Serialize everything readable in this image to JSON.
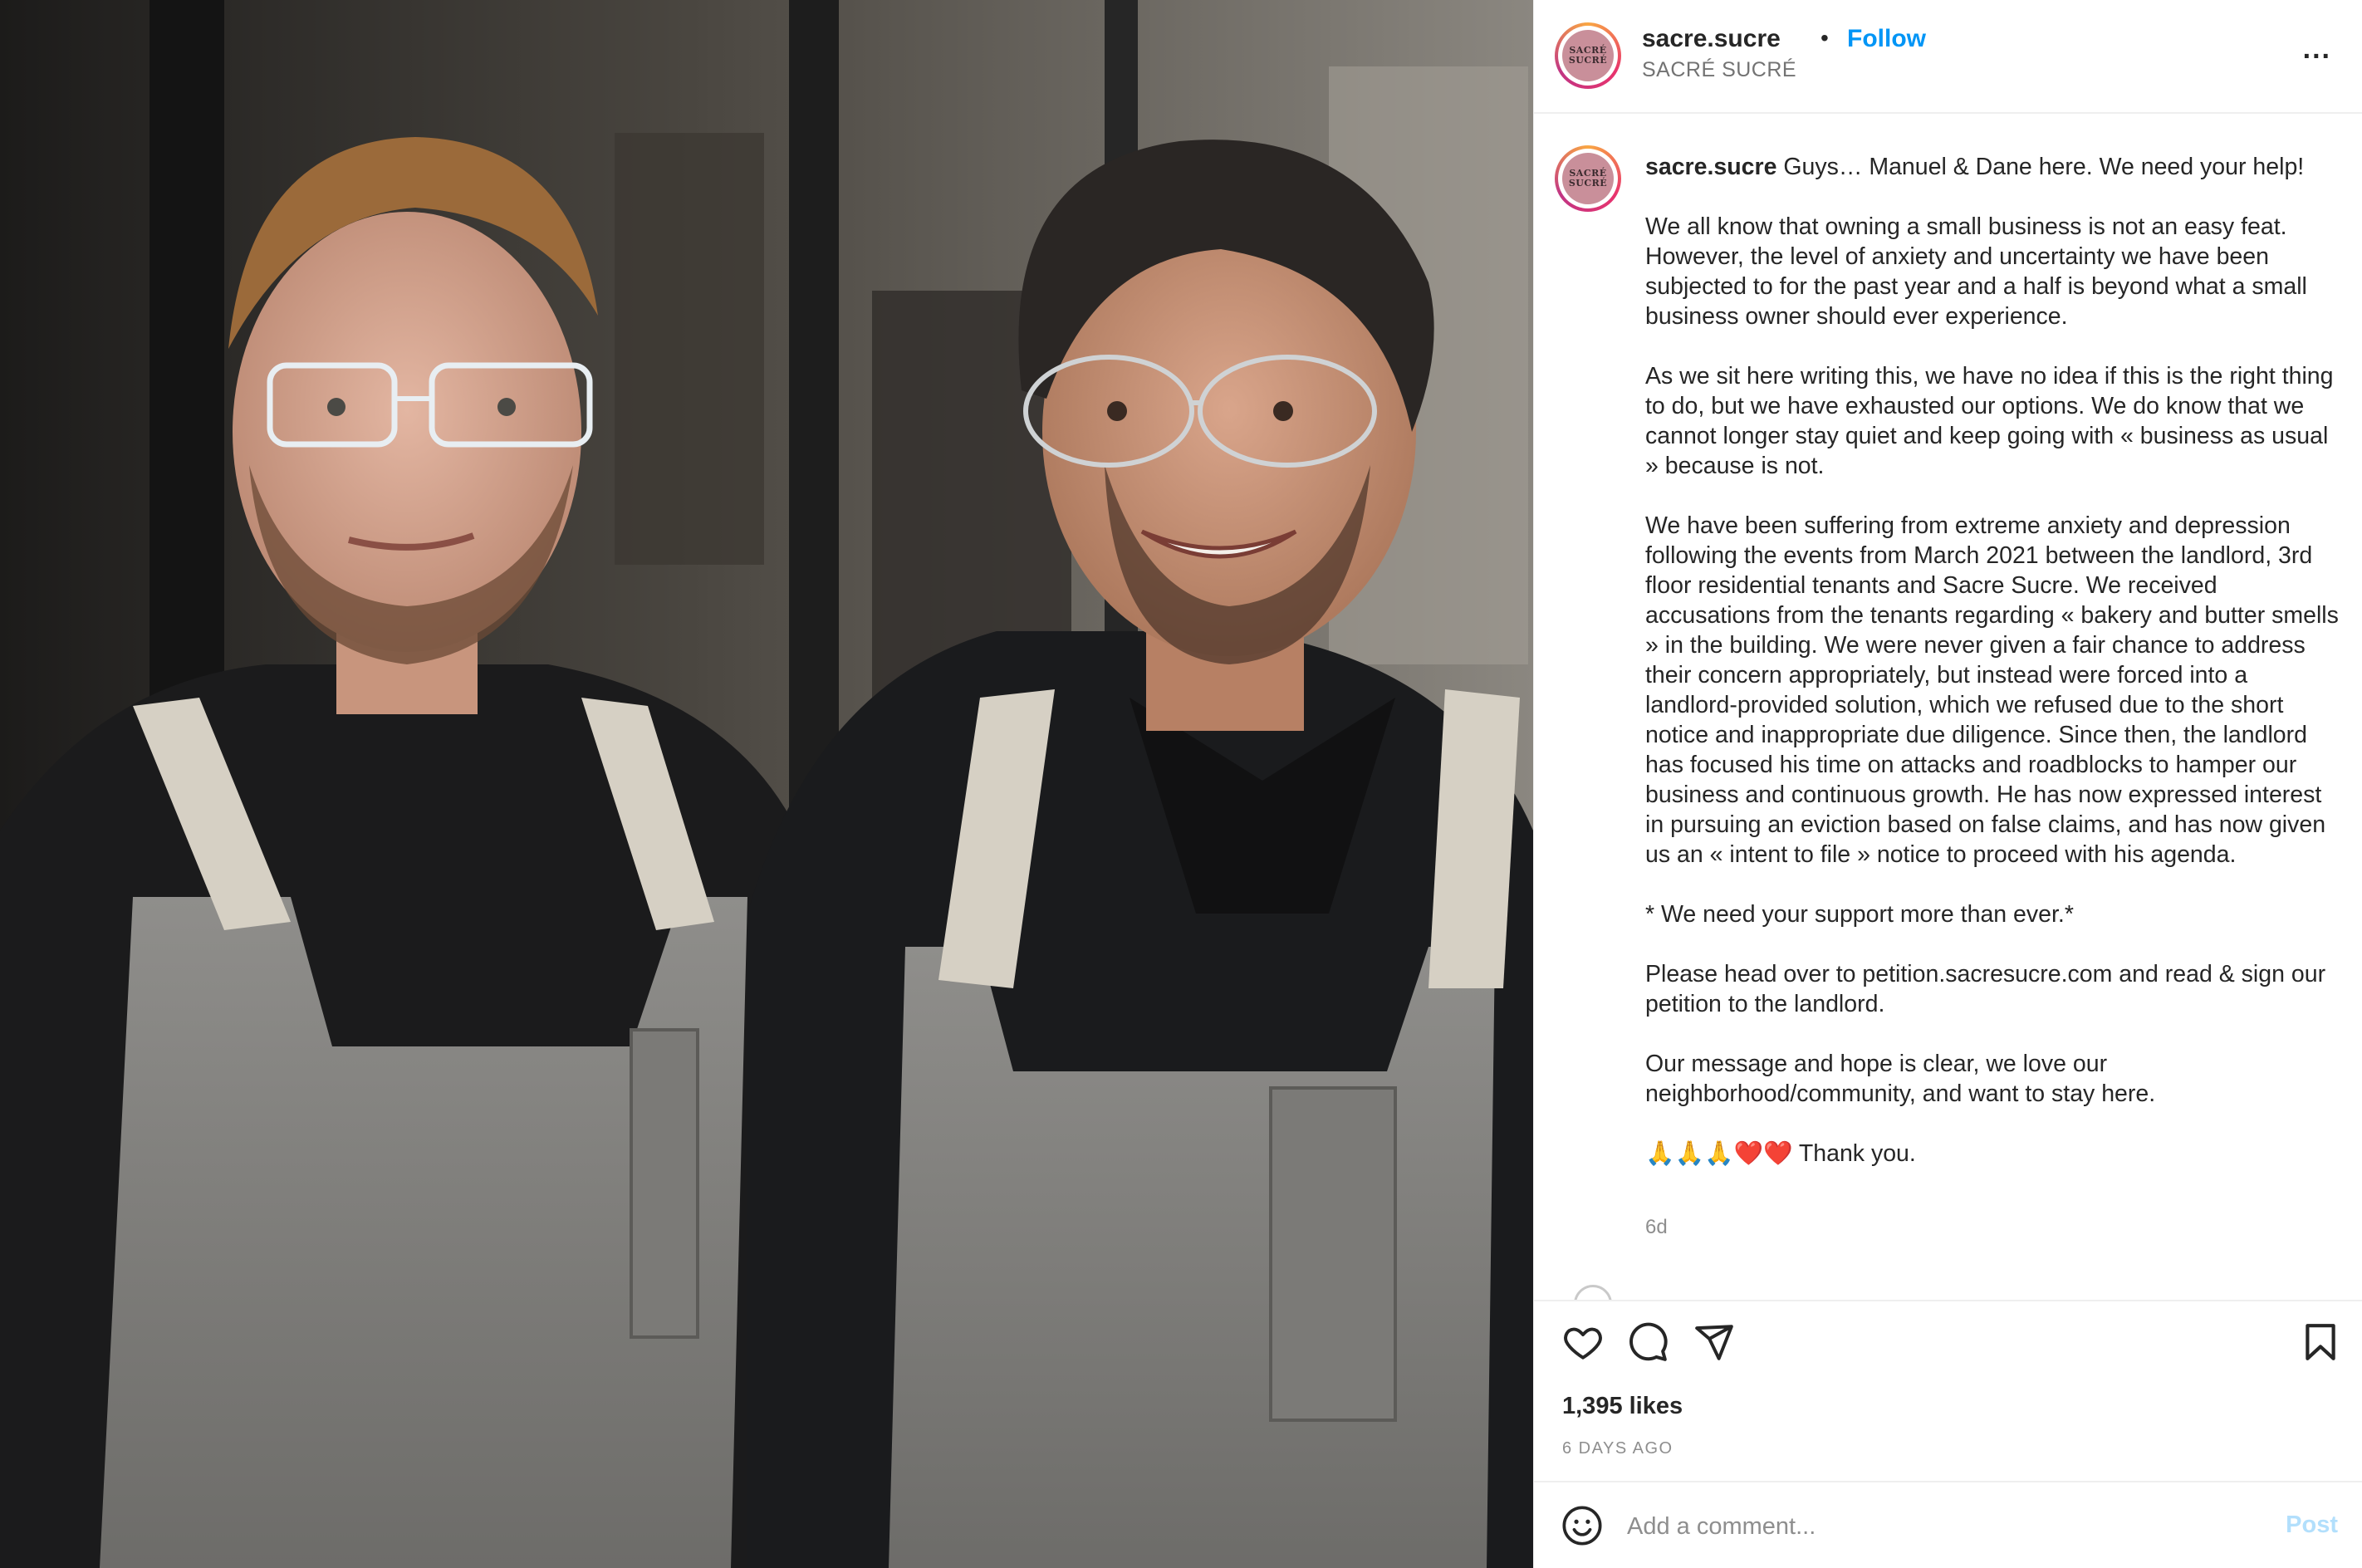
{
  "post": {
    "photo_alt": "Two bakers in grey aprons",
    "avatar_text_line1": "SACRÉ",
    "avatar_text_line2": "SUCRÉ"
  },
  "header": {
    "username": "sacre.sucre",
    "separator": "•",
    "follow_label": "Follow",
    "subtitle": "SACRÉ SUCRÉ",
    "more_icon": "more-horizontal-icon",
    "more_label": "..."
  },
  "caption": {
    "username": "sacre.sucre",
    "text": " Guys… Manuel & Dane here. We need your help!\n\nWe all know that owning a small business is not an easy feat. However, the level of anxiety and uncertainty we have been subjected to for the past year and a half is beyond what a small business owner should ever experience.\n\nAs we sit here writing this, we have no idea if this is the right thing to do, but we have exhausted our options. We do know that we cannot longer stay quiet and keep going with « business as usual » because is not.\n\nWe have been suffering from extreme anxiety and depression following the events from March 2021 between the landlord, 3rd floor residential tenants and Sacre Sucre. We received accusations from the tenants regarding « bakery and butter smells » in the building. We were never given a fair chance to address their concern appropriately, but instead were forced into a landlord-provided solution, which we refused due to the short notice and inappropriate due diligence. Since then, the landlord has focused his time on attacks and roadblocks to hamper our business and continuous growth. He has now expressed interest in pursuing an eviction based on false claims, and has now given us an « intent to file » notice to proceed with his agenda.\n\n* We need your support more than ever.*\n\nPlease head over to petition.sacresucre.com and read & sign our petition to the landlord.\n\nOur message and hope is clear, we love our neighborhood/community, and want to stay here.\n\n🙏🙏🙏❤️❤️ Thank you.",
    "time": "6d"
  },
  "actions": {
    "icons": [
      "heart-icon",
      "comment-icon",
      "share-icon",
      "bookmark-icon"
    ],
    "likes": "1,395 likes",
    "posted_ago": "6 DAYS AGO"
  },
  "comment_box": {
    "emoji_icon": "smiley-icon",
    "placeholder": "Add a comment...",
    "post_label": "Post"
  },
  "colors": {
    "link_blue": "#0095f6",
    "post_disabled": "#b2dffc",
    "secondary_text": "#737373",
    "border": "#efefef"
  }
}
